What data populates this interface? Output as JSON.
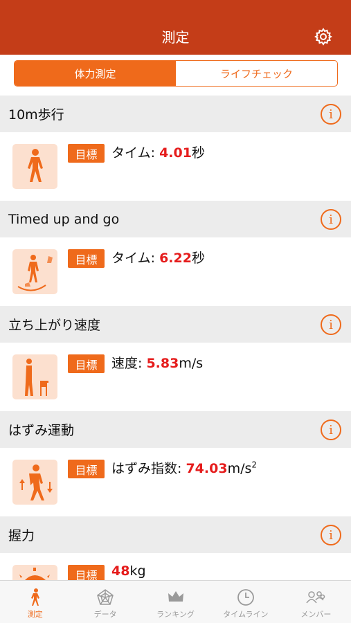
{
  "header": {
    "title": "測定"
  },
  "segments": {
    "physical": "体力測定",
    "lifecheck": "ライフチェック"
  },
  "target_label": "目標",
  "sections": [
    {
      "title": "10m歩行",
      "metric_label": "タイム: ",
      "value": "4.01",
      "unit": "秒"
    },
    {
      "title": "Timed up and go",
      "metric_label": "タイム: ",
      "value": "6.22",
      "unit": "秒"
    },
    {
      "title": "立ち上がり速度",
      "metric_label": "速度: ",
      "value": "5.83",
      "unit": "m/s"
    },
    {
      "title": "はずみ運動",
      "metric_label": "はずみ指数: ",
      "value": "74.03",
      "unit": "m/s",
      "unit_sup": "2"
    },
    {
      "title": "握力",
      "metric_label": "",
      "value": "48",
      "unit": "kg"
    }
  ],
  "tabs": [
    {
      "label": "測定",
      "icon": "walking-person-icon"
    },
    {
      "label": "データ",
      "icon": "pentagon-chart-icon"
    },
    {
      "label": "ランキング",
      "icon": "crown-icon"
    },
    {
      "label": "タイムライン",
      "icon": "clock-icon"
    },
    {
      "label": "メンバー",
      "icon": "group-icon"
    }
  ],
  "colors": {
    "header": "#c43d18",
    "accent": "#ef6a1b",
    "value": "#e51c1c"
  }
}
